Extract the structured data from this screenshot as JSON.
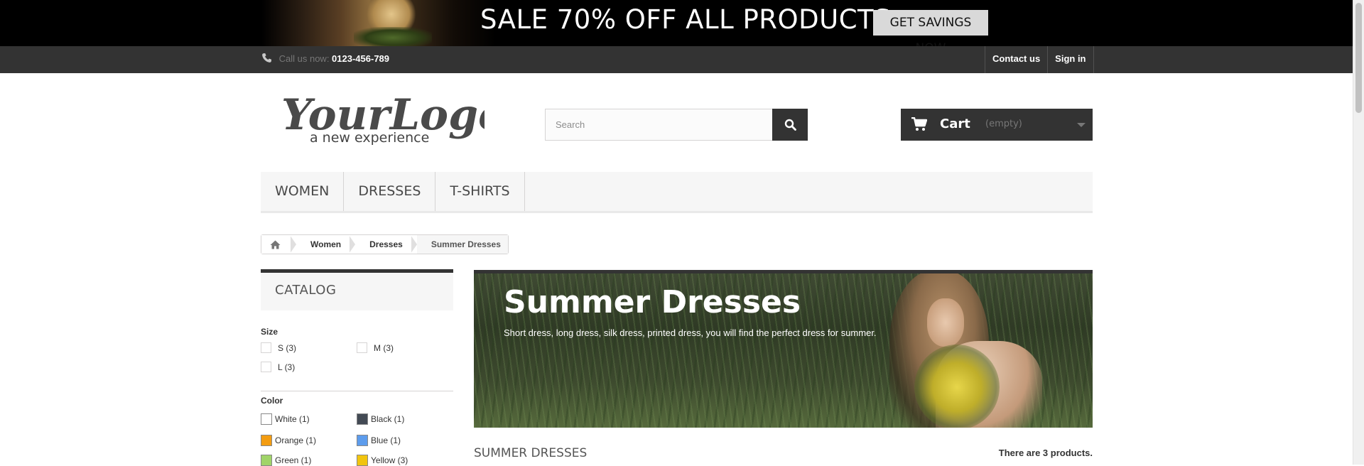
{
  "promo": {
    "headline": "SALE 70% OFF ALL PRODUCTS",
    "cta_label": "GET SAVINGS NOW"
  },
  "topbar": {
    "call_label": "Call us now: ",
    "phone": "0123-456-789",
    "links": [
      "Contact us",
      "Sign in"
    ]
  },
  "header": {
    "logo_main": "YourLogo",
    "logo_tagline": "a new experience",
    "search_placeholder": "Search",
    "cart_label": "Cart",
    "cart_status": "(empty)"
  },
  "menu": {
    "items": [
      "WOMEN",
      "DRESSES",
      "T-SHIRTS"
    ]
  },
  "breadcrumb": {
    "items": [
      "Women",
      "Dresses",
      "Summer Dresses"
    ]
  },
  "sidebar": {
    "catalog_title": "CATALOG",
    "size_title": "Size",
    "sizes": [
      "S (3)",
      "M (3)",
      "L (3)"
    ],
    "color_title": "Color",
    "colors": [
      {
        "label": "White (1)",
        "hex": "#ffffff"
      },
      {
        "label": "Black (1)",
        "hex": "#434a54"
      },
      {
        "label": "Orange (1)",
        "hex": "#f39c11"
      },
      {
        "label": "Blue (1)",
        "hex": "#5d9cec"
      },
      {
        "label": "Green (1)",
        "hex": "#a0d468"
      },
      {
        "label": "Yellow (3)",
        "hex": "#f1c40f"
      }
    ]
  },
  "category": {
    "title": "Summer Dresses",
    "description": "Short dress, long dress, silk dress, printed dress, you will find the perfect dress for summer.",
    "heading": "SUMMER DRESSES",
    "product_count": "There are 3 products."
  }
}
